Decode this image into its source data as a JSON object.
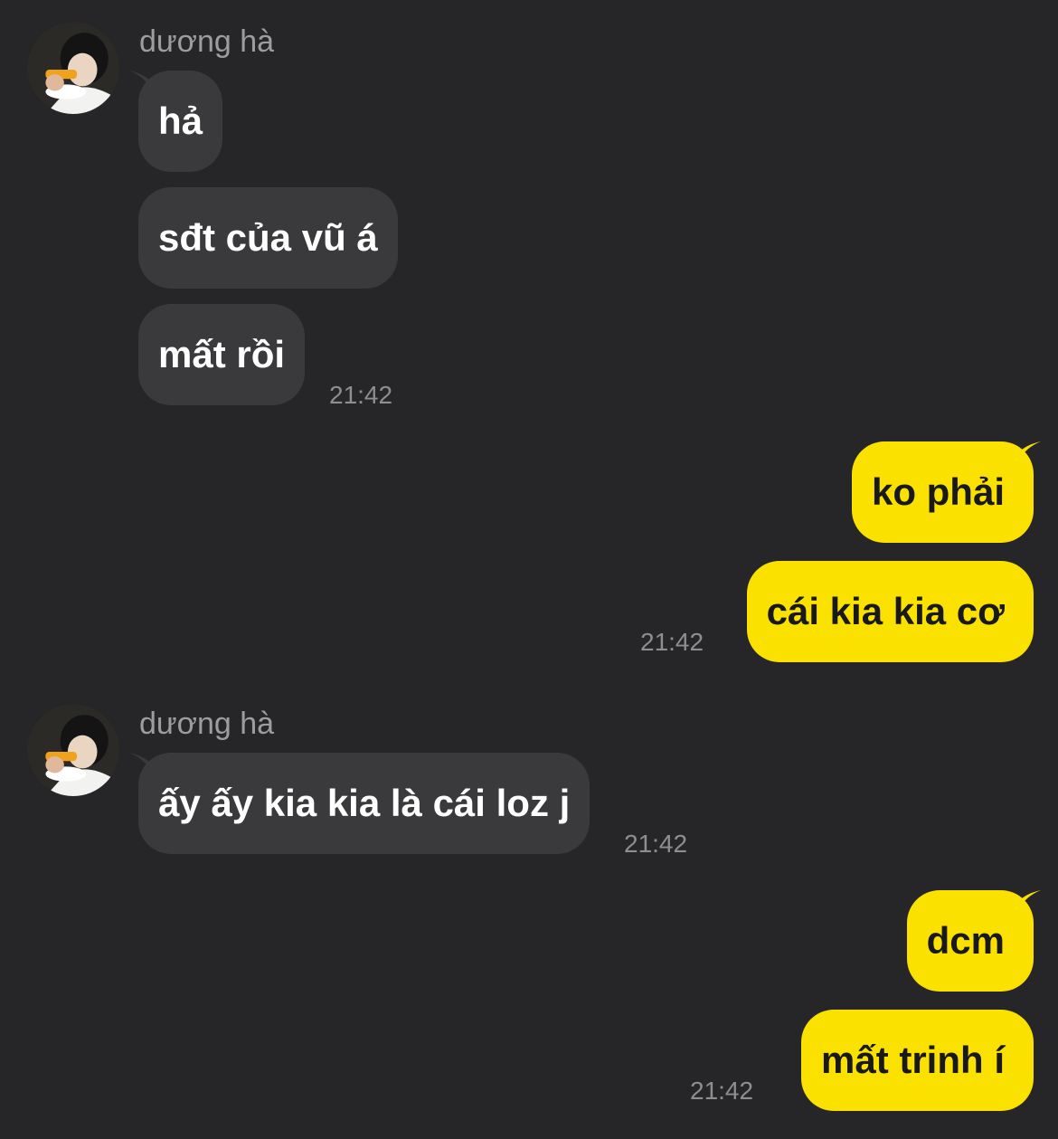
{
  "colors": {
    "background": "#262628",
    "incoming_bubble": "#3a3a3c",
    "outgoing_bubble": "#fae100",
    "sender_text": "#9d9d9f",
    "time_text": "#8e8e90"
  },
  "groups": [
    {
      "direction": "incoming",
      "sender": "dương hà",
      "avatar_icon": "user-avatar",
      "messages": [
        "hả",
        "sđt của vũ á",
        "mất rồi"
      ],
      "time": "21:42"
    },
    {
      "direction": "outgoing",
      "messages": [
        "ko phải",
        "cái kia kia cơ"
      ],
      "time": "21:42"
    },
    {
      "direction": "incoming",
      "sender": "dương hà",
      "avatar_icon": "user-avatar",
      "messages": [
        "ấy ấy kia kia là cái loz j"
      ],
      "time": "21:42"
    },
    {
      "direction": "outgoing",
      "messages": [
        "dcm",
        "mất trinh í"
      ],
      "time": "21:42"
    }
  ]
}
